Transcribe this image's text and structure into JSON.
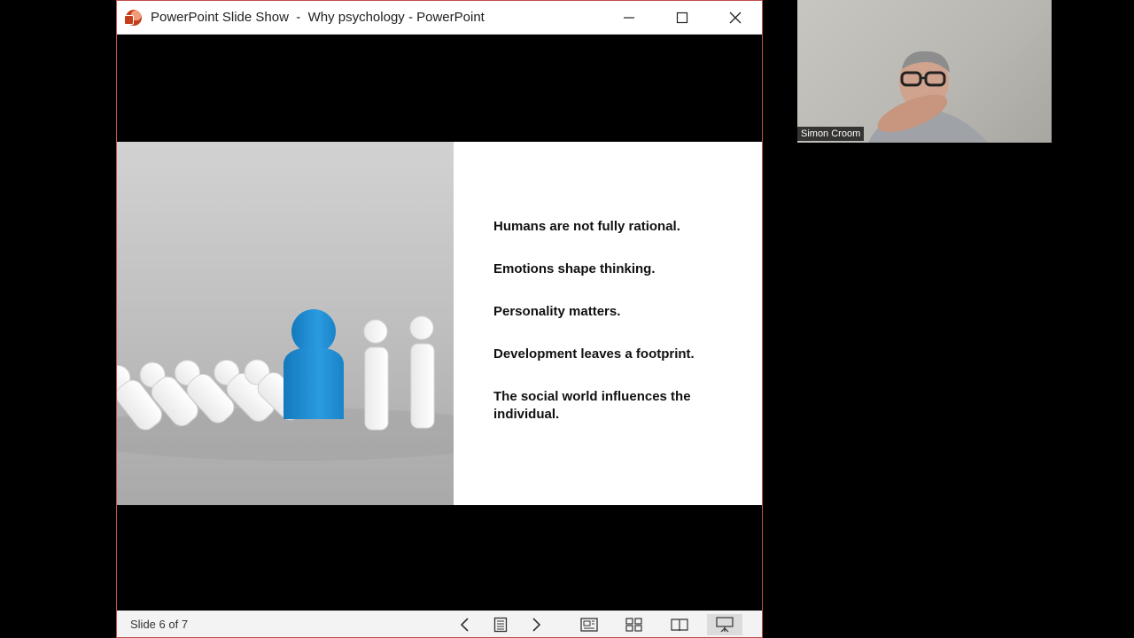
{
  "window": {
    "title": "PowerPoint Slide Show  -  Why psychology - PowerPoint",
    "app_icon": "powerpoint-icon",
    "controls": [
      "minimize-icon",
      "maximize-icon",
      "close-icon"
    ],
    "accent": "#c0504d"
  },
  "slide": {
    "bullets": [
      "Humans are not fully rational.",
      "Emotions shape thinking.",
      "Personality matters.",
      "Development leaves a footprint.",
      "The social world influences the individual."
    ],
    "highlight_color": "#1e8fd6"
  },
  "statusbar": {
    "slide_counter": "Slide 6 of 7",
    "icons": [
      "previous-icon",
      "slide-list-icon",
      "next-icon",
      "normal-view-icon",
      "slide-sorter-icon",
      "reading-view-icon",
      "slideshow-icon"
    ]
  },
  "participant": {
    "name": "Simon Croom"
  }
}
